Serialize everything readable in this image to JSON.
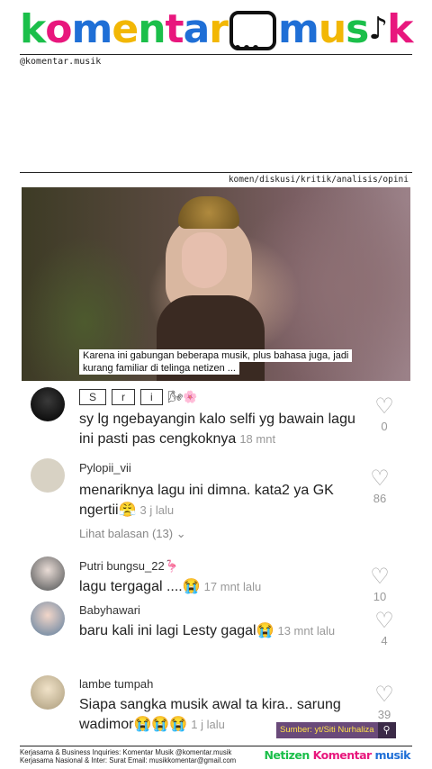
{
  "brand": {
    "logo_left": "komentar",
    "logo_right": "musik",
    "handle": "@komentar.musik",
    "tags": "komen/diskusi/kritik/analisis/opini"
  },
  "colors": {
    "k": "#1bbf4a",
    "o": "#e8177d",
    "m": "#1f6fd6",
    "e": "#f2b705",
    "n": "#1bbf4a",
    "t": "#e8177d",
    "a": "#1f6fd6",
    "r": "#f2b705",
    "source_bg": "#6a4a7a",
    "source_text": "#ffe14a"
  },
  "video": {
    "caption": "Karena ini gabungan beberapa musik, plus bahasa juga, jadi kurang familiar di telinga netizen ..."
  },
  "comments": [
    {
      "username_chars": [
        "S",
        "r",
        "i"
      ],
      "username_emoji": "🌬🌸",
      "text": "sy lg ngebayangin kalo selfi yg bawain lagu ini pasti pas cengkoknya",
      "time": "18 mnt",
      "likes": "0",
      "avatar_icon": "avatar-dark"
    },
    {
      "username": "Pylopii_vii",
      "text": "menariknya lagu ini dimna. kata2 ya GK ngertii😤",
      "time": "3 j lalu",
      "likes": "86",
      "replies": "Lihat balasan (13)",
      "avatar_icon": "avatar-plain"
    },
    {
      "username": "Putri bungsu_22🦩",
      "text": "lagu tergagal ....😭",
      "time": "17 mnt lalu",
      "likes": "10",
      "avatar_icon": "avatar-photo"
    },
    {
      "username": "Babyhawari",
      "text": "baru kali ini lagi Lesty gagal😭",
      "time": "13 mnt lalu",
      "likes": "4",
      "avatar_icon": "avatar-photo"
    },
    {
      "username": "lambe tumpah",
      "text": "Siapa sangka musik awal ta kira.. sarung wadimor😭😭😭",
      "time": "1 j lalu",
      "likes": "39",
      "avatar_icon": "avatar-photo"
    }
  ],
  "source": {
    "label": "Sumber: yt/Siti Nurhaliza",
    "icon": "search-icon"
  },
  "footer": {
    "line1": "Kerjasama & Business Inquiries: Komentar Musik @komentar.musik",
    "line2": "Kerjasama Nasional & Inter: Surat Email: musikkomentar@gmail.com",
    "brand": "Netizen Komentar musik"
  }
}
